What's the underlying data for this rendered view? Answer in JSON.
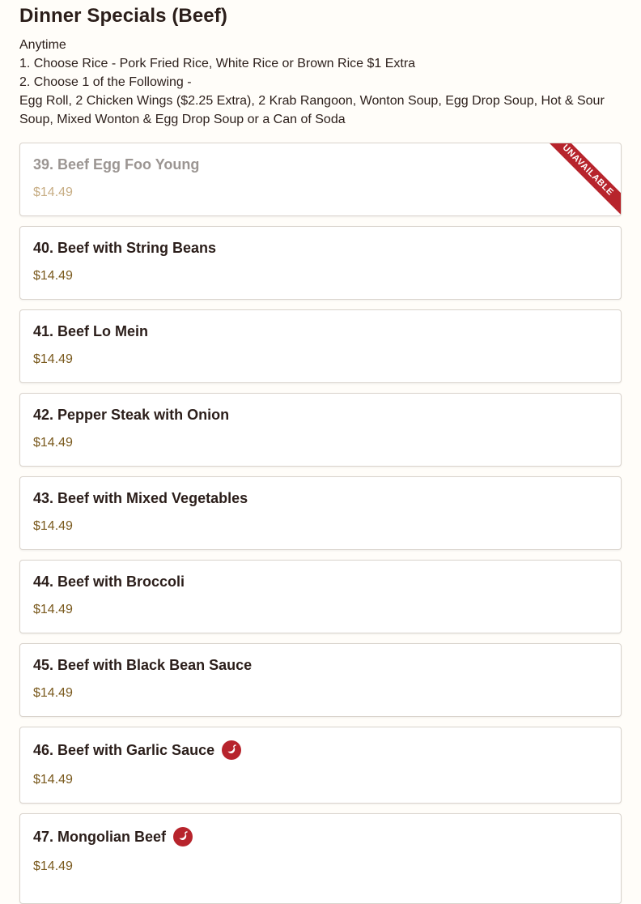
{
  "section": {
    "title": "Dinner Specials (Beef)",
    "description": [
      "Anytime",
      "1. Choose Rice - Pork Fried Rice, White Rice or Brown Rice $1 Extra",
      "2. Choose 1 of the Following -",
      "Egg Roll, 2 Chicken Wings ($2.25 Extra), 2 Krab Rangoon, Wonton Soup, Egg Drop Soup, Hot & Sour Soup, Mixed Wonton & Egg Drop Soup or a Can of Soda"
    ]
  },
  "items": [
    {
      "name": "39. Beef Egg Foo Young",
      "price": "$14.49",
      "badge": "UNAVAILABLE",
      "spicy": false
    },
    {
      "name": "40. Beef with String Beans",
      "price": "$14.49",
      "spicy": false
    },
    {
      "name": "41. Beef Lo Mein",
      "price": "$14.49",
      "spicy": false
    },
    {
      "name": "42. Pepper Steak with Onion",
      "price": "$14.49",
      "spicy": false
    },
    {
      "name": "43. Beef with Mixed Vegetables",
      "price": "$14.49",
      "spicy": false
    },
    {
      "name": "44. Beef with Broccoli",
      "price": "$14.49",
      "spicy": false
    },
    {
      "name": "45. Beef with Black Bean Sauce",
      "price": "$14.49",
      "spicy": false
    },
    {
      "name": "46. Beef with Garlic Sauce",
      "price": "$14.49",
      "spicy": true
    },
    {
      "name": "47. Mongolian Beef",
      "price": "$14.49",
      "spicy": true
    }
  ],
  "colors": {
    "price": "#7a5a1e",
    "spicy": "#b7242c",
    "unavailable_ribbon": "#b7242c"
  },
  "icons": {
    "spicy": "chili-pepper-icon"
  }
}
